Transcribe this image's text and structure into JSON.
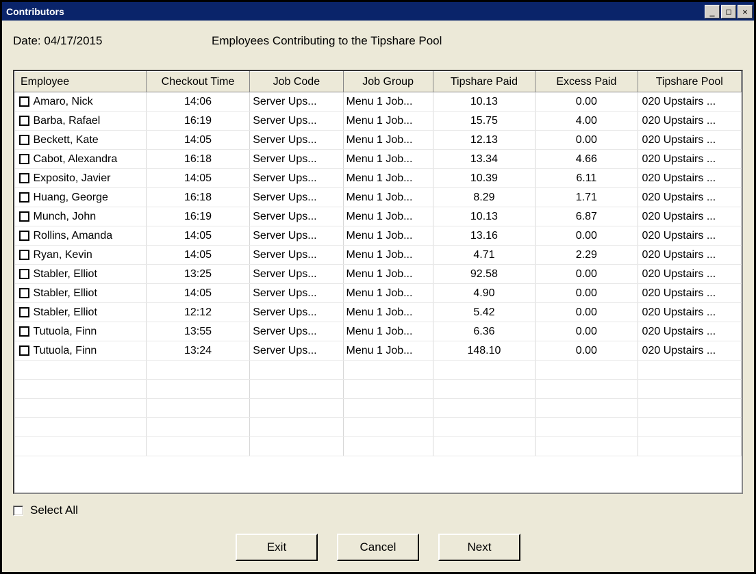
{
  "window": {
    "title": "Contributors"
  },
  "header": {
    "date_label": "Date: 04/17/2015",
    "page_title": "Employees Contributing to the Tipshare Pool"
  },
  "columns": {
    "employee": "Employee",
    "checkout_time": "Checkout Time",
    "job_code": "Job Code",
    "job_group": "Job Group",
    "tipshare_paid": "Tipshare Paid",
    "excess_paid": "Excess Paid",
    "tipshare_pool": "Tipshare Pool"
  },
  "rows": [
    {
      "employee": "Amaro, Nick",
      "checkout_time": "14:06",
      "job_code": "Server Ups...",
      "job_group": "Menu 1 Job...",
      "tipshare_paid": "10.13",
      "excess_paid": "0.00",
      "tipshare_pool": "020 Upstairs ..."
    },
    {
      "employee": "Barba, Rafael",
      "checkout_time": "16:19",
      "job_code": "Server Ups...",
      "job_group": "Menu 1 Job...",
      "tipshare_paid": "15.75",
      "excess_paid": "4.00",
      "tipshare_pool": "020 Upstairs ..."
    },
    {
      "employee": "Beckett, Kate",
      "checkout_time": "14:05",
      "job_code": "Server Ups...",
      "job_group": "Menu 1 Job...",
      "tipshare_paid": "12.13",
      "excess_paid": "0.00",
      "tipshare_pool": "020 Upstairs ..."
    },
    {
      "employee": "Cabot, Alexandra",
      "checkout_time": "16:18",
      "job_code": "Server Ups...",
      "job_group": "Menu 1 Job...",
      "tipshare_paid": "13.34",
      "excess_paid": "4.66",
      "tipshare_pool": "020 Upstairs ..."
    },
    {
      "employee": "Exposito, Javier",
      "checkout_time": "14:05",
      "job_code": "Server Ups...",
      "job_group": "Menu 1 Job...",
      "tipshare_paid": "10.39",
      "excess_paid": "6.11",
      "tipshare_pool": "020 Upstairs ..."
    },
    {
      "employee": "Huang, George",
      "checkout_time": "16:18",
      "job_code": "Server Ups...",
      "job_group": "Menu 1 Job...",
      "tipshare_paid": "8.29",
      "excess_paid": "1.71",
      "tipshare_pool": "020 Upstairs ..."
    },
    {
      "employee": "Munch, John",
      "checkout_time": "16:19",
      "job_code": "Server Ups...",
      "job_group": "Menu 1 Job...",
      "tipshare_paid": "10.13",
      "excess_paid": "6.87",
      "tipshare_pool": "020 Upstairs ..."
    },
    {
      "employee": "Rollins, Amanda",
      "checkout_time": "14:05",
      "job_code": "Server Ups...",
      "job_group": "Menu 1 Job...",
      "tipshare_paid": "13.16",
      "excess_paid": "0.00",
      "tipshare_pool": "020 Upstairs ..."
    },
    {
      "employee": "Ryan, Kevin",
      "checkout_time": "14:05",
      "job_code": "Server Ups...",
      "job_group": "Menu 1 Job...",
      "tipshare_paid": "4.71",
      "excess_paid": "2.29",
      "tipshare_pool": "020 Upstairs ..."
    },
    {
      "employee": "Stabler, Elliot",
      "checkout_time": "13:25",
      "job_code": "Server Ups...",
      "job_group": "Menu 1 Job...",
      "tipshare_paid": "92.58",
      "excess_paid": "0.00",
      "tipshare_pool": "020 Upstairs ..."
    },
    {
      "employee": "Stabler, Elliot",
      "checkout_time": "14:05",
      "job_code": "Server Ups...",
      "job_group": "Menu 1 Job...",
      "tipshare_paid": "4.90",
      "excess_paid": "0.00",
      "tipshare_pool": "020 Upstairs ..."
    },
    {
      "employee": "Stabler, Elliot",
      "checkout_time": "12:12",
      "job_code": "Server Ups...",
      "job_group": "Menu 1 Job...",
      "tipshare_paid": "5.42",
      "excess_paid": "0.00",
      "tipshare_pool": "020 Upstairs ..."
    },
    {
      "employee": "Tutuola, Finn",
      "checkout_time": "13:55",
      "job_code": "Server Ups...",
      "job_group": "Menu 1 Job...",
      "tipshare_paid": "6.36",
      "excess_paid": "0.00",
      "tipshare_pool": "020 Upstairs ..."
    },
    {
      "employee": "Tutuola, Finn",
      "checkout_time": "13:24",
      "job_code": "Server Ups...",
      "job_group": "Menu 1 Job...",
      "tipshare_paid": "148.10",
      "excess_paid": "0.00",
      "tipshare_pool": "020 Upstairs ..."
    }
  ],
  "empty_rows": 5,
  "footer": {
    "select_all_label": "Select All",
    "buttons": {
      "exit": "Exit",
      "cancel": "Cancel",
      "next": "Next"
    }
  }
}
